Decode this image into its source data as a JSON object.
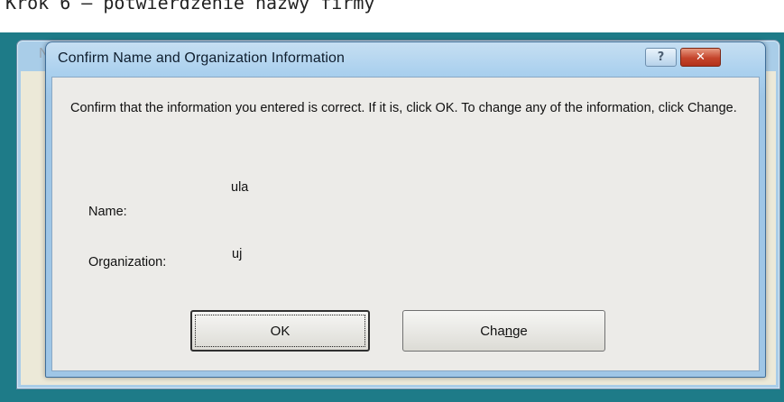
{
  "top_caption": "Krok 6 – potwierdzenie nazwy firmy",
  "back_window": {
    "title": "N"
  },
  "dialog": {
    "title": "Confirm Name and Organization Information",
    "help_button": "?",
    "close_button": "✕",
    "message": "Confirm that the information you entered is correct. If it is, click OK. To change any of the information, click Change.",
    "fields": {
      "name_label": "Name:",
      "name_value": "ula",
      "organization_label": "Organization:",
      "organization_value": "uj"
    },
    "buttons": {
      "ok": "OK",
      "change_pre": "Cha",
      "change_mnemonic": "n",
      "change_post": "ge"
    }
  }
}
